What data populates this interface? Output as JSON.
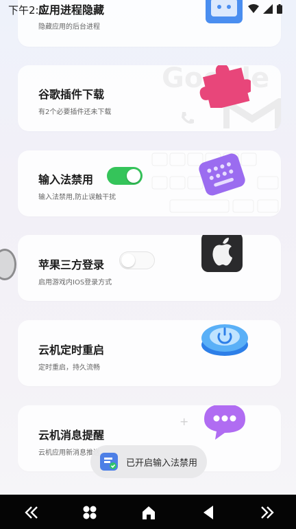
{
  "status_bar": {
    "time": "下午2:0"
  },
  "cards": [
    {
      "title": "应用进程隐藏",
      "subtitle": "隐藏应用的后台进程"
    },
    {
      "title": "谷歌插件下载",
      "subtitle": "有2个必要插件还未下载",
      "deco_text": "Google"
    },
    {
      "title": "输入法禁用",
      "subtitle": "输入法禁用,防止误触干扰",
      "toggle_on": true
    },
    {
      "title": "苹果三方登录",
      "subtitle": "启用游戏内IOS登录方式",
      "toggle_on": false
    },
    {
      "title": "云机定时重启",
      "subtitle": "定时重启，持久流畅"
    },
    {
      "title": "云机消息提醒",
      "subtitle": "云机应用新消息推送"
    }
  ],
  "toast": {
    "text": "已开启输入法禁用"
  },
  "navbar": {
    "icons": [
      "double-chevron-left-icon",
      "apps-grid-icon",
      "home-icon",
      "back-triangle-icon",
      "double-chevron-right-icon"
    ]
  },
  "colors": {
    "toggle_on": "#35c45a",
    "accent_pink": "#e8467a",
    "accent_purple": "#9b6cf0",
    "accent_blue": "#3a8cf0"
  }
}
